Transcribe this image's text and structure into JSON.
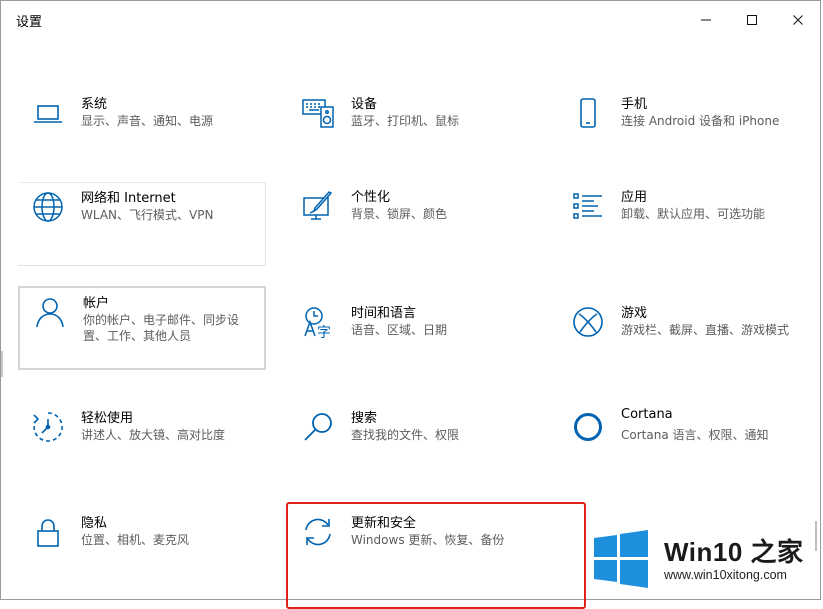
{
  "window": {
    "title": "设置",
    "controls": [
      "minimize-icon",
      "maximize-icon",
      "close-icon"
    ]
  },
  "tiles": [
    {
      "name": "系统",
      "desc": "显示、声音、通知、电源",
      "icon": "laptop-icon"
    },
    {
      "name": "设备",
      "desc": "蓝牙、打印机、鼠标",
      "icon": "devices-icon"
    },
    {
      "name": "手机",
      "desc": "连接 Android 设备和 iPhone",
      "icon": "phone-icon"
    },
    {
      "name": "网络和 Internet",
      "desc": "WLAN、飞行模式、VPN",
      "icon": "globe-icon"
    },
    {
      "name": "个性化",
      "desc": "背景、锁屏、颜色",
      "icon": "personalization-icon"
    },
    {
      "name": "应用",
      "desc": "卸载、默认应用、可选功能",
      "icon": "apps-list-icon"
    },
    {
      "name": "帐户",
      "desc": "你的帐户、电子邮件、同步设\n置、工作、其他人员",
      "icon": "person-icon"
    },
    {
      "name": "时间和语言",
      "desc": "语音、区域、日期",
      "icon": "time-language-icon"
    },
    {
      "name": "游戏",
      "desc": "游戏栏、截屏、直播、游戏模式",
      "icon": "xbox-icon"
    },
    {
      "name": "轻松使用",
      "desc": "讲述人、放大镜、高对比度",
      "icon": "ease-of-access-icon"
    },
    {
      "name": "搜索",
      "desc": "查找我的文件、权限",
      "icon": "magnifier-icon"
    },
    {
      "name": "Cortana",
      "desc": "Cortana 语言、权限、通知",
      "icon": "cortana-icon"
    },
    {
      "name": "隐私",
      "desc": "位置、相机、麦克风",
      "icon": "lock-icon"
    },
    {
      "name": "更新和安全",
      "desc": "Windows 更新、恢复、备份",
      "icon": "sync-icon"
    }
  ],
  "highlighted_tile": "更新和安全",
  "colors": {
    "accent": "#0063b1",
    "highlight": "#e0201b",
    "win_logo": "#1e8fdc"
  },
  "watermark": {
    "title": "Win10 之家",
    "url": "www.win10xitong.com"
  }
}
